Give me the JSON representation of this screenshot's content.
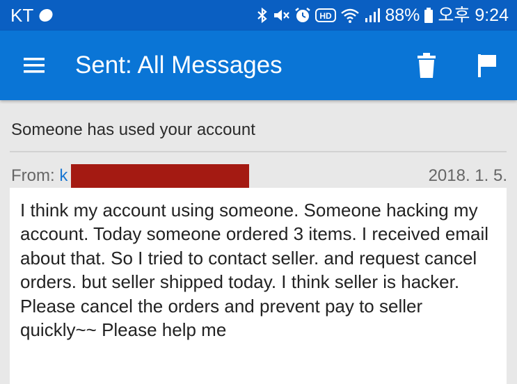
{
  "status_bar": {
    "carrier": "KT",
    "battery": "88%",
    "time": "오후 9:24",
    "icons": [
      "bluetooth-icon",
      "mute-icon",
      "alarm-icon",
      "hd-icon",
      "wifi-icon",
      "signal-icon",
      "battery-icon"
    ]
  },
  "header": {
    "title": "Sent: All Messages",
    "icons": [
      "menu-icon",
      "trash-icon",
      "flag-icon"
    ]
  },
  "message": {
    "subject": "Someone has used your account",
    "from_label": "From:",
    "from_value": "k",
    "date": "2018. 1. 5.",
    "body": "I think my account using someone. Someone hacking my account. Today someone ordered 3 items. I received email about that. So I tried to contact seller. and request cancel orders. but seller shipped today. I think seller is hacker. Please cancel the orders and prevent pay to seller quickly~~ Please help me"
  },
  "colors": {
    "status_bar": "#0a5fc2",
    "app_bar": "#0a75d6",
    "redaction": "#a41a12",
    "link": "#1976d2",
    "background": "#e8e8e8"
  }
}
